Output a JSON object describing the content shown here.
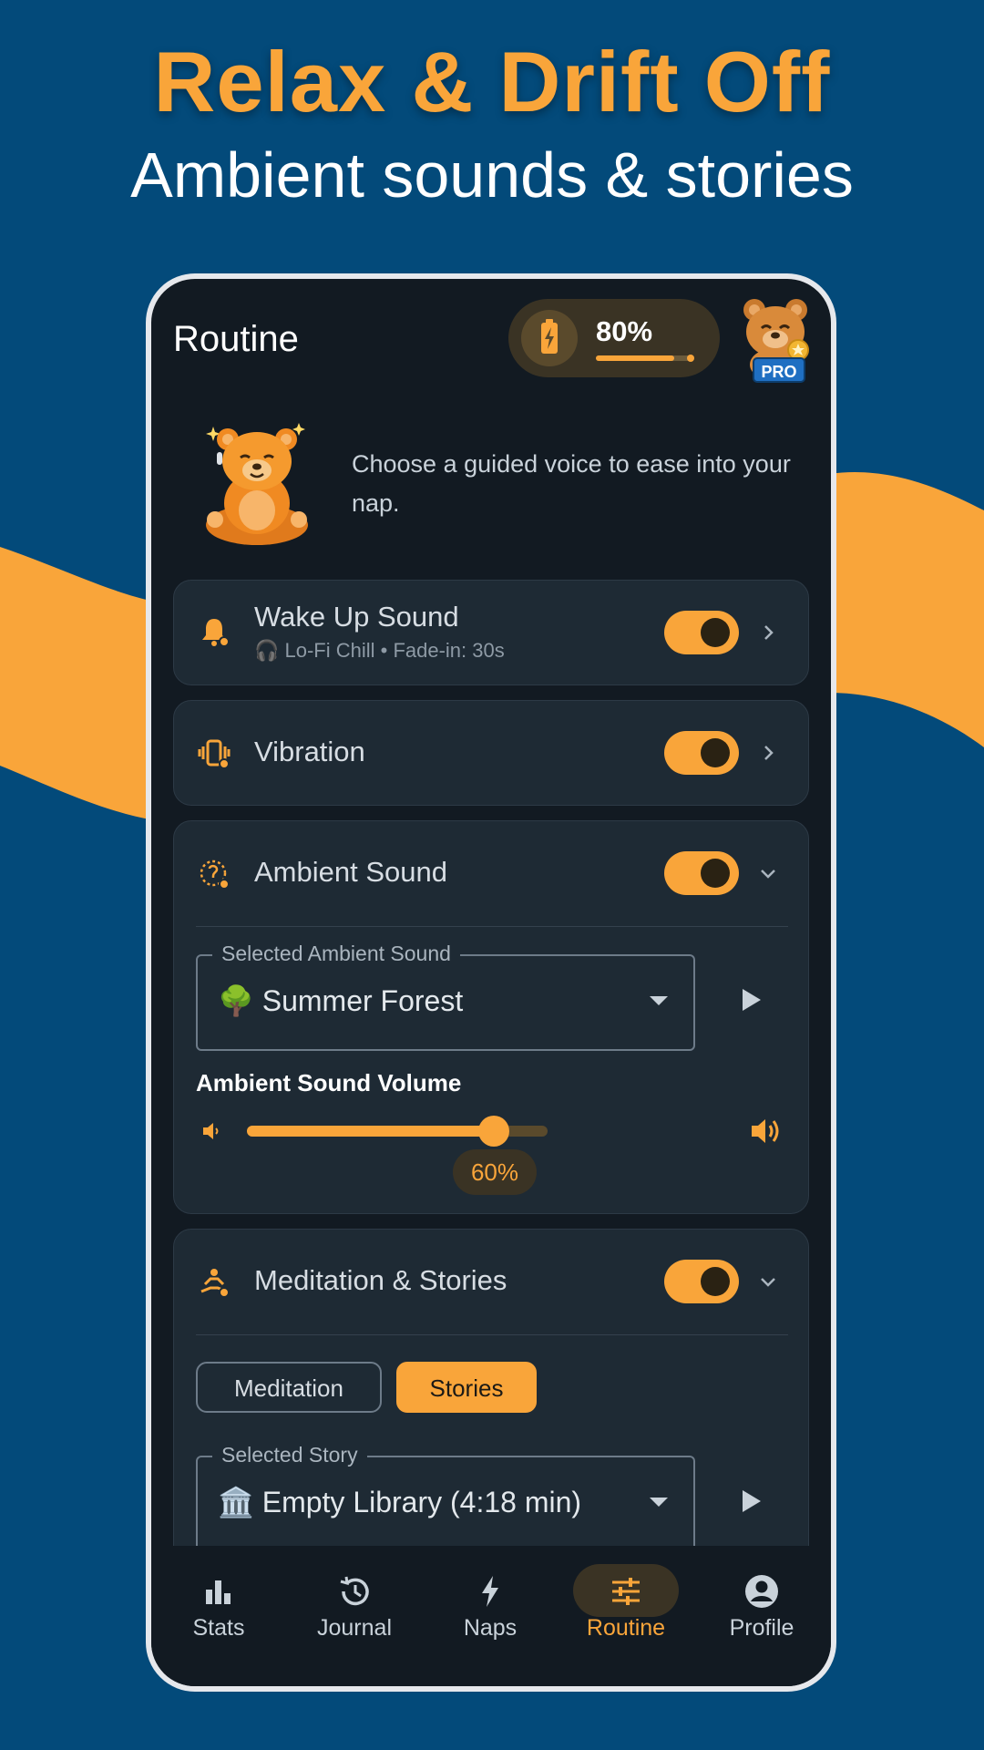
{
  "promo": {
    "title": "Relax & Drift Off",
    "subtitle": "Ambient sounds & stories"
  },
  "header": {
    "title": "Routine",
    "battery_percent": "80%",
    "battery_level": 0.8,
    "badge": "PRO"
  },
  "intro": {
    "text": "Choose a guided voice to ease into your nap."
  },
  "wake_up": {
    "title": "Wake Up Sound",
    "subtitle": "🎧 Lo-Fi Chill • Fade-in: 30s",
    "enabled": true
  },
  "vibration": {
    "title": "Vibration",
    "enabled": true
  },
  "ambient": {
    "title": "Ambient Sound",
    "enabled": true,
    "select_label": "Selected Ambient Sound",
    "select_value": "🌳 Summer Forest",
    "volume_label": "Ambient Sound Volume",
    "volume_level": 0.6,
    "volume_text": "60%"
  },
  "meditation": {
    "title": "Meditation & Stories",
    "enabled": true,
    "tabs": [
      "Meditation",
      "Stories"
    ],
    "active_tab": "Stories",
    "select_label": "Selected Story",
    "select_value": "🏛️ Empty Library (4:18 min)"
  },
  "nav": {
    "items": [
      {
        "label": "Stats",
        "icon": "bar-chart-icon"
      },
      {
        "label": "Journal",
        "icon": "history-icon"
      },
      {
        "label": "Naps",
        "icon": "lightning-icon"
      },
      {
        "label": "Routine",
        "icon": "sliders-icon"
      },
      {
        "label": "Profile",
        "icon": "account-icon"
      }
    ],
    "active": "Routine"
  },
  "colors": {
    "background": "#034a7a",
    "accent": "#f9a53a",
    "phone_bg": "#121a22",
    "card_bg": "#1e2a34"
  }
}
